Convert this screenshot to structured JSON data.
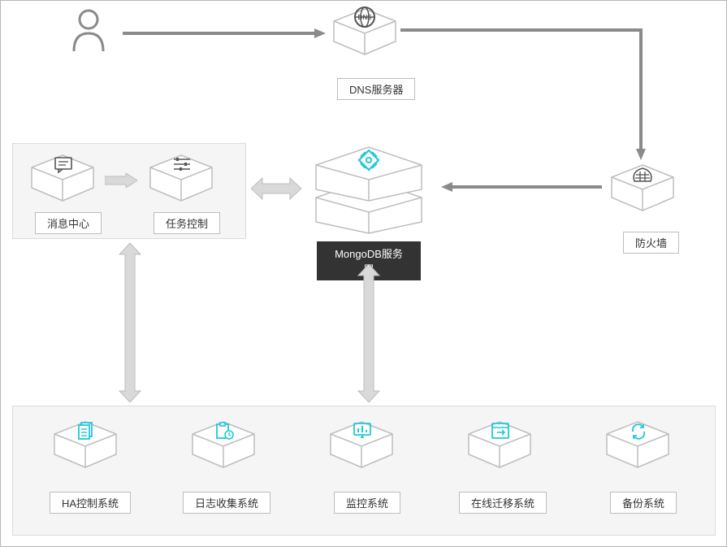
{
  "nodes": {
    "dns": "DNS服务器",
    "firewall": "防火墙",
    "message_center": "消息中心",
    "task_control": "任务控制",
    "mongodb": "MongoDB服务器",
    "ha": "HA控制系统",
    "log": "日志收集系统",
    "monitor": "监控系统",
    "migration": "在线迁移系统",
    "backup": "备份系统"
  },
  "edges": [
    {
      "from": "user",
      "to": "dns",
      "dir": "right"
    },
    {
      "from": "dns",
      "to": "firewall",
      "dir": "down-right"
    },
    {
      "from": "firewall",
      "to": "mongodb",
      "dir": "left"
    },
    {
      "from": "left-panel",
      "to": "mongodb",
      "dir": "both",
      "axis": "h"
    },
    {
      "from": "message_center",
      "to": "task_control",
      "dir": "right",
      "style": "block"
    },
    {
      "from": "left-panel",
      "to": "bottom-panel",
      "dir": "both",
      "axis": "v"
    },
    {
      "from": "mongodb",
      "to": "bottom-panel",
      "dir": "both",
      "axis": "v"
    }
  ],
  "colors": {
    "accent": "#1FC8DB",
    "panel_bg": "#F5F5F5",
    "border": "#DADADA",
    "arrow": "#8a8a8a",
    "block_arrow": "#D9D9D9"
  }
}
